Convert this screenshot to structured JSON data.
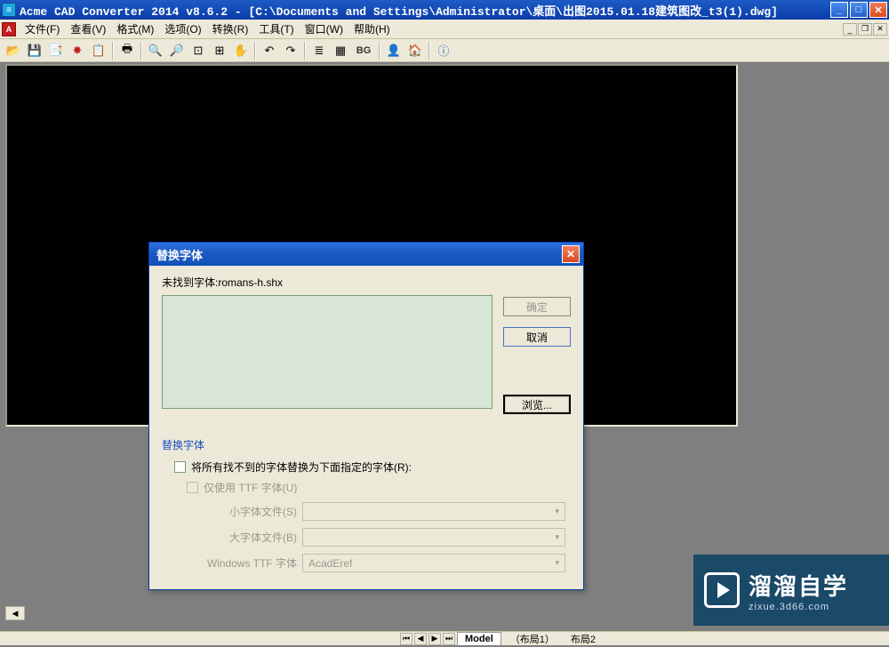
{
  "window": {
    "title": "Acme CAD Converter 2014 v8.6.2 - [C:\\Documents and Settings\\Administrator\\桌面\\出图2015.01.18建筑图改_t3(1).dwg]"
  },
  "menu": {
    "items": [
      "文件(F)",
      "查看(V)",
      "格式(M)",
      "选项(O)",
      "转换(R)",
      "工具(T)",
      "窗口(W)",
      "帮助(H)"
    ]
  },
  "toolbar": {
    "bg_label": "BG"
  },
  "dialog": {
    "title": "替换字体",
    "message": "未找到字体:romans-h.shx",
    "ok": "确定",
    "cancel": "取消",
    "browse": "浏览...",
    "group_label": "替换字体",
    "check_all_label": "将所有找不到的字体替换为下面指定的字体(R):",
    "check_ttf_label": "仅使用 TTF 字体(U)",
    "small_font_label": "小字体文件(S)",
    "big_font_label": "大字体文件(B)",
    "ttf_font_label": "Windows TTF 字体",
    "ttf_value": "AcadEref"
  },
  "tabs": {
    "model": "Model",
    "layout1": "（布局1）",
    "layout2": "布局2"
  },
  "watermark": {
    "big": "溜溜自学",
    "small": "zixue.3d66.com"
  }
}
